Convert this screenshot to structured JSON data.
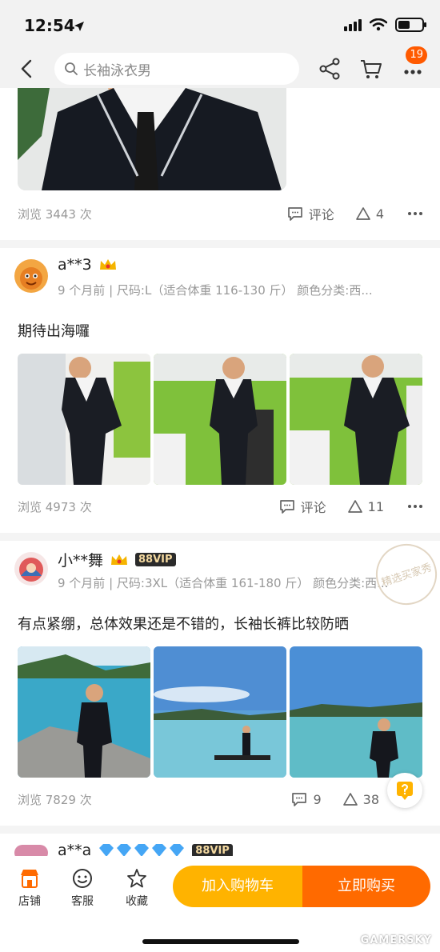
{
  "status": {
    "time": "12:54"
  },
  "nav": {
    "search_placeholder": "长袖泳衣男",
    "badge_count": "19"
  },
  "top_post": {
    "views": "浏览 3443 次",
    "comment_label": "评论",
    "like_count": "4"
  },
  "reviews": [
    {
      "username": "a**3",
      "meta": "9 个月前 | 尺码:L（适合体重 116-130 斤） 颜色分类:西...",
      "text": "期待出海囉",
      "views": "浏览 4973 次",
      "comment_label": "评论",
      "like_count": "11"
    },
    {
      "username": "小**舞",
      "vip": "88VIP",
      "stamp": "精选买家秀",
      "meta": "9 个月前 | 尺码:3XL（适合体重 161-180 斤） 颜色分类:西...",
      "text": "有点紧绷，总体效果还是不错的，长袖长裤比较防晒",
      "views": "浏览 7829 次",
      "comment_count": "9",
      "like_count": "38"
    },
    {
      "username": "a**a",
      "vip": "88VIP"
    }
  ],
  "bottom": {
    "store": "店铺",
    "service": "客服",
    "favorite": "收藏",
    "add_to_cart": "加入购物车",
    "buy_now": "立即购买"
  },
  "watermark": "GAMERSKY",
  "colors": {
    "accent_orange": "#ff6a00",
    "accent_yellow": "#ffb300",
    "badge": "#ff5a00"
  }
}
